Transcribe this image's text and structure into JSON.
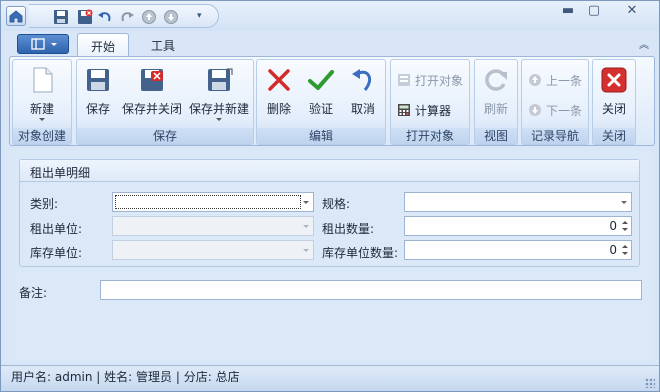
{
  "ribbon": {
    "tabs": [
      {
        "label": "开始",
        "active": true
      },
      {
        "label": "工具",
        "active": false
      }
    ],
    "groups": {
      "create": {
        "label": "对象创建",
        "new_label": "新建"
      },
      "save": {
        "label": "保存",
        "save_label": "保存",
        "save_close_label": "保存并关闭",
        "save_new_label": "保存并新建"
      },
      "edit": {
        "label": "编辑",
        "delete_label": "删除",
        "verify_label": "验证",
        "cancel_label": "取消"
      },
      "open": {
        "label": "打开对象",
        "open_object_label": "打开对象",
        "calculator_label": "计算器"
      },
      "view": {
        "label": "视图",
        "refresh_label": "刷新"
      },
      "nav": {
        "label": "记录导航",
        "prev_label": "上一条",
        "next_label": "下一条"
      },
      "close": {
        "label": "关闭",
        "close_label": "关闭"
      }
    }
  },
  "form": {
    "section_title": "租出单明细",
    "category_label": "类别:",
    "category_value": "",
    "spec_label": "规格:",
    "spec_value": "",
    "rent_unit_label": "租出单位:",
    "rent_unit_value": "",
    "rent_qty_label": "租出数量:",
    "rent_qty_value": "0",
    "stock_unit_label": "库存单位:",
    "stock_unit_value": "",
    "stock_qty_label": "库存单位数量:",
    "stock_qty_value": "0",
    "remark_label": "备注:",
    "remark_value": ""
  },
  "status": {
    "user": "用户名: admin",
    "name": "姓名: 管理员",
    "branch": "分店: 总店",
    "separator": "|"
  },
  "colors": {
    "accent": "#2e62ad",
    "delete_red": "#d32a2a",
    "verify_green": "#2f9a2f",
    "close_red": "#d43030"
  },
  "icons": [
    "home-icon",
    "save-icon",
    "save-close-icon",
    "undo-icon",
    "redo-icon",
    "up-icon",
    "down-icon",
    "new-doc-icon",
    "delete-icon",
    "verify-icon",
    "cancel-icon",
    "calculator-icon",
    "refresh-icon",
    "close-icon"
  ]
}
